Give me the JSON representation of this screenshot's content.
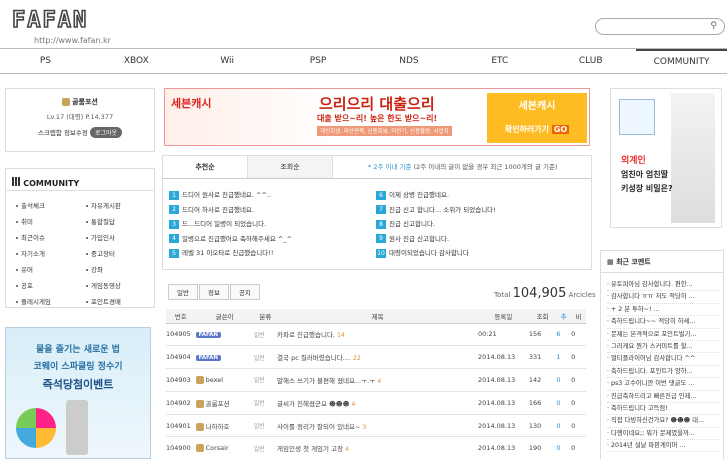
{
  "header": {
    "logo": "FAFAN",
    "url": "http://www.fafan.kr"
  },
  "nav": [
    "PS",
    "XBOX",
    "Wii",
    "PSP",
    "NDS",
    "ETC",
    "CLUB",
    "COMMUNITY"
  ],
  "user": {
    "name": "골룸포션",
    "level": "Lv.17 (대령) P.14,377",
    "scrap": "스크랩함",
    "edit": "정보수정",
    "logout": "로그아웃"
  },
  "community": {
    "title": "COMMUNITY",
    "items": [
      "출석체크",
      "자유게시판",
      "취미",
      "통합질답",
      "최근이슈",
      "가입인사",
      "자기소개",
      "중고장터",
      "유머",
      "강좌",
      "공포",
      "게임동영상",
      "플레시게임",
      "포인트경매"
    ]
  },
  "left_ad": {
    "text1": "물을 즐기는 새로운 법",
    "text2": "코웨이 스파클링 정수기",
    "text3": "즉석당첨이벤트"
  },
  "top_ad": {
    "brand": "세븐캐시",
    "headline": "으리으리 대출으리",
    "line2": "대출 받으~리! 높은 한도 받으~리!",
    "tags": "개인회생, 파산면책, 신용회복, 미연기, 신용불량, 사업자",
    "side_brand": "세븐캐시",
    "side_text": "확인하러가기",
    "go": "GO"
  },
  "right_ad": {
    "line1": "외계인",
    "line2": "엄친아 엄친딸",
    "line3": "키성장 비밀은?"
  },
  "tabs": {
    "active": "추천순",
    "other": "조회순",
    "note_highlight": "* 2주 이내 기준",
    "note": "(2주 이내의 글이 없을 경우 최근 1000개의 글 기준)"
  },
  "ranking_left": [
    {
      "n": "1",
      "t": "드디어 원사로 진급했네요. ^^.."
    },
    {
      "n": "2",
      "t": "드디어 하사로 진급했네요."
    },
    {
      "n": "3",
      "t": "드...드디어 일병이 되었습니다."
    },
    {
      "n": "4",
      "t": "일병으로 진급했어요 축하해주세요 ^_^"
    },
    {
      "n": "5",
      "t": "레벨 31 이오타로 진급했습니다!!"
    }
  ],
  "ranking_right": [
    {
      "n": "6",
      "t": "이제 상병 진급했네요."
    },
    {
      "n": "7",
      "t": "진급 신고 합니다... 소위가 되었습니다!"
    },
    {
      "n": "8",
      "t": "진급 신고합니다."
    },
    {
      "n": "9",
      "t": "원사 진급 신고합니다."
    },
    {
      "n": "10",
      "t": "대령이되었습니다 감사합니다"
    }
  ],
  "board": {
    "cats": [
      "일반",
      "정보",
      "공지"
    ],
    "total_label": "Total",
    "total": "104,905",
    "total_suffix": "Arcicles",
    "headers": [
      "번호",
      "글쓴이",
      "분류",
      "제목",
      "등록일",
      "조회",
      "추",
      "비"
    ],
    "rows": [
      {
        "no": "104905",
        "author": "FAFAN",
        "cat": "일반",
        "title": "카파로 진급했습니다.",
        "cnt": "14",
        "date": "00:21",
        "views": "156",
        "rec": "6",
        "no_rec": "0"
      },
      {
        "no": "104904",
        "author": "FAFAN",
        "cat": "일반",
        "title": "결국 pc 질러버렸습니다....",
        "cnt": "22",
        "date": "2014.08.13",
        "views": "331",
        "rec": "1",
        "no_rec": "0"
      },
      {
        "no": "104903",
        "author": "bexel",
        "cat": "일반",
        "title": "말해스 쓰기가 불편해 졌네요...ㅜ.ㅜ",
        "cnt": "4",
        "date": "2014.08.13",
        "views": "142",
        "rec": "0",
        "no_rec": "0"
      },
      {
        "no": "104902",
        "author": "골룸포션",
        "cat": "일반",
        "title": "글씨가 진해졌군요 ☻☻☻",
        "cnt": "4",
        "date": "2014.08.13",
        "views": "166",
        "rec": "0",
        "no_rec": "0"
      },
      {
        "no": "104901",
        "author": "나하하호",
        "cat": "일반",
        "title": "사이를 정리가 잘되어 있네요~",
        "cnt": "3",
        "date": "2014.08.13",
        "views": "130",
        "rec": "0",
        "no_rec": "0"
      },
      {
        "no": "104900",
        "author": "Corsair",
        "cat": "일반",
        "title": "게임인생 첫 게임기 고장",
        "cnt": "4",
        "date": "2014.08.13",
        "views": "190",
        "rec": "0",
        "no_rec": "0"
      }
    ]
  },
  "comments": {
    "title": "최근 코멘트",
    "items": [
      "유토피아님 감사합니다. 편한...",
      "감사합니다 ㅠㅠ 저도 적당히 ...",
      "+ 2 분 투하~! ...",
      "축하드립니다~~ 적당히 하세...",
      "문제는 본격적으로 포인트벌기...",
      "그러게요 뭔가 스커미트를 할...",
      "멀티플라이어님 감사합니다 ^^",
      "축하드립니다. 포인트가 양하...",
      "ps3 고수이니깐 이번 댓글도 ...",
      "진급축하드리고 빠른진급 인제...",
      "축하드립니다 고득점!",
      "직접 다빙하신건가요? ☻☻☻ 대...",
      "다행이네요;; 뭐가 문제였을까...",
      "2014년 설날 파판게이머 ..."
    ]
  }
}
